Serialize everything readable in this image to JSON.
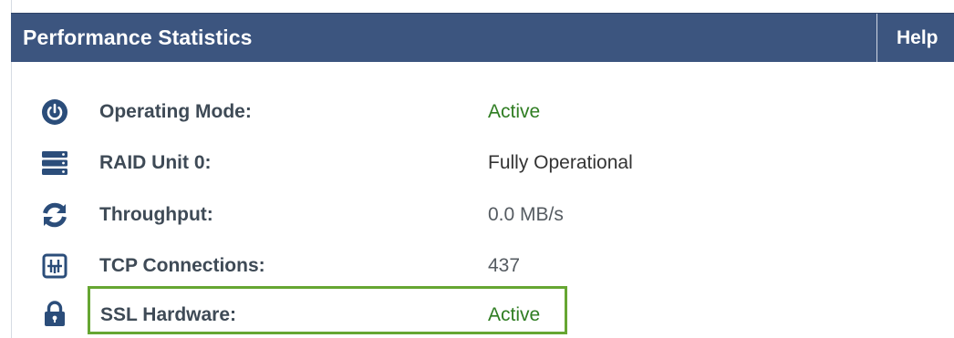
{
  "header": {
    "title": "Performance Statistics",
    "help_label": "Help"
  },
  "stats": [
    {
      "label": "Operating Mode:",
      "value": "Active",
      "icon": "power-icon"
    },
    {
      "label": "RAID Unit 0:",
      "value": "Fully Operational",
      "icon": "storage-icon"
    },
    {
      "label": "Throughput:",
      "value": "0.0 MB/s",
      "icon": "refresh-icon"
    },
    {
      "label": "TCP Connections:",
      "value": "437",
      "icon": "connections-icon"
    },
    {
      "label": "SSL Hardware:",
      "value": "Active",
      "icon": "lock-icon"
    }
  ],
  "colors": {
    "header_bg": "#3c557f",
    "icon": "#2b4d7a",
    "active": "#2f7d22",
    "highlight": "#66a632"
  }
}
